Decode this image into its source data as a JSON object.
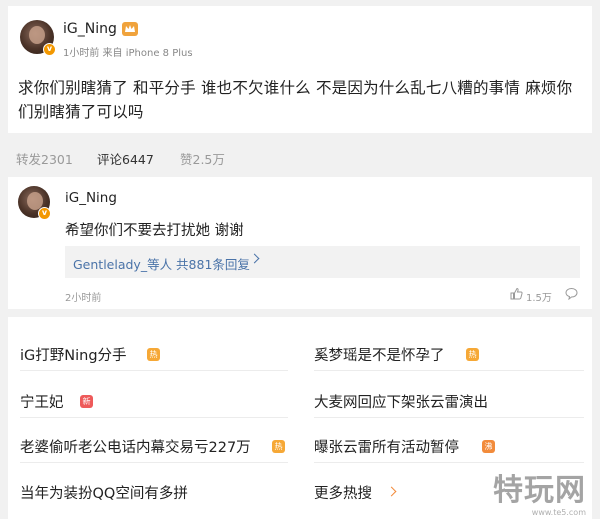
{
  "post": {
    "username": "iG_Ning",
    "meta": "1小时前 来自 iPhone 8 Plus",
    "text": "求你们别瞎猜了 和平分手 谁也不欠谁什么 不是因为什么乱七八糟的事情 麻烦你们别瞎猜了可以吗"
  },
  "tabs": [
    {
      "label": "转发2301"
    },
    {
      "label": "评论6447"
    },
    {
      "label": "赞2.5万"
    }
  ],
  "comment": {
    "username": "iG_Ning",
    "text": "希望你们不要去打扰她 谢谢",
    "reply_link": "Gentlelady_等人 共881条回复",
    "time": "2小时前",
    "likes": "1.5万"
  },
  "hot_search": [
    {
      "label": "iG打野Ning分手",
      "badge": "热",
      "badge_type": "hot"
    },
    {
      "label": "奚梦瑶是不是怀孕了",
      "badge": "热",
      "badge_type": "hot"
    },
    {
      "label": "宁王妃",
      "badge": "新",
      "badge_type": "new"
    },
    {
      "label": "大麦网回应下架张云雷演出",
      "badge": "",
      "badge_type": ""
    },
    {
      "label": "老婆偷听老公电话内幕交易亏227万",
      "badge": "热",
      "badge_type": "hot"
    },
    {
      "label": "曝张云雷所有活动暂停",
      "badge": "沸",
      "badge_type": "boil"
    },
    {
      "label": "当年为装扮QQ空间有多拼",
      "badge": "",
      "badge_type": ""
    },
    {
      "label": "更多热搜",
      "badge": "",
      "badge_type": "more"
    }
  ],
  "watermark": {
    "text": "特玩网",
    "url": "www.te5.com"
  },
  "colors": {
    "link": "#4a73a8",
    "hot": "#f6a836",
    "new": "#ee5a5a",
    "boil": "#f28b3b",
    "verified": "#f39800"
  }
}
